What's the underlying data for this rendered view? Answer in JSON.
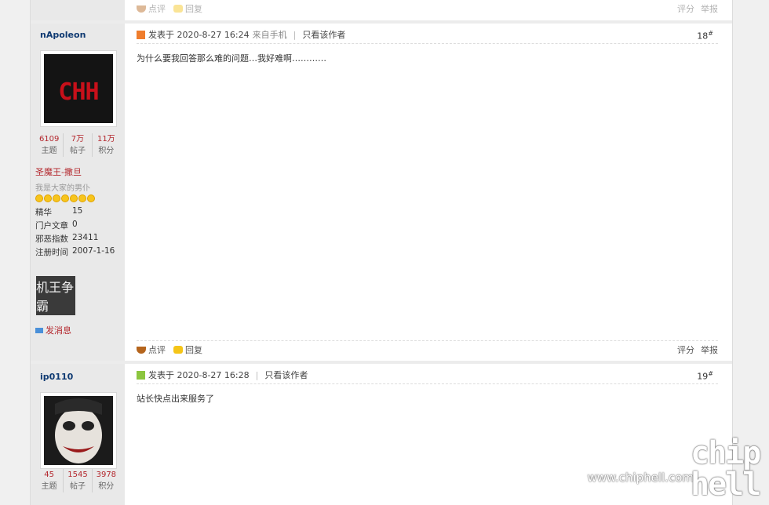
{
  "prev_post_actions": {
    "rate": "点评",
    "reply": "回复",
    "score": "评分",
    "report": "举报"
  },
  "posts": [
    {
      "author": "nApoleon",
      "avatar_text": "CHH",
      "stats": [
        {
          "num": "6109",
          "label": "主题"
        },
        {
          "num": "7万",
          "label": "帖子"
        },
        {
          "num": "11万",
          "label": "积分"
        }
      ],
      "title": "圣魔王-撒旦",
      "motto": "我是大家的男仆",
      "star_count": 7,
      "info": [
        {
          "k": "精华",
          "v": "15"
        },
        {
          "k": "门户文章",
          "v": "0"
        },
        {
          "k": "邪恶指数",
          "v": "23411"
        },
        {
          "k": "注册时间",
          "v": "2007-1-16"
        }
      ],
      "badge_text": "机王争霸",
      "pm": "发消息",
      "posted_label": "发表于",
      "time": "2020-8-27 16:24",
      "device": "来自手机",
      "only_author": "只看该作者",
      "floor": "18",
      "floor_mark": "#",
      "content": "为什么要我回答那么难的问题…我好难啊…………",
      "actions": {
        "rate": "点评",
        "reply": "回复",
        "score": "评分",
        "report": "举报"
      }
    },
    {
      "author": "ip0110",
      "stats": [
        {
          "num": "45",
          "label": "主题"
        },
        {
          "num": "1545",
          "label": "帖子"
        },
        {
          "num": "3978",
          "label": "积分"
        }
      ],
      "posted_label": "发表于",
      "time": "2020-8-27 16:28",
      "only_author": "只看该作者",
      "floor": "19",
      "floor_mark": "#",
      "content": "站长快点出来服务了"
    }
  ],
  "watermark": {
    "url": "www.chiphell.com",
    "logo": "chip hell"
  },
  "colors": {
    "accent": "#b3262c",
    "username": "#0f3a72",
    "sidebar": "#e9e9e9"
  }
}
